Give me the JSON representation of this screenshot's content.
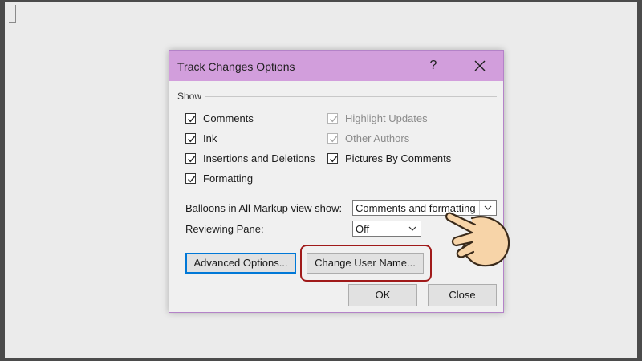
{
  "dialog": {
    "title": "Track Changes Options",
    "help_label": "?",
    "show_group_label": "Show",
    "checkboxes_left": [
      {
        "label": "Comments",
        "checked": true,
        "enabled": true
      },
      {
        "label": "Ink",
        "checked": true,
        "enabled": true
      },
      {
        "label": "Insertions and Deletions",
        "checked": true,
        "enabled": true
      },
      {
        "label": "Formatting",
        "checked": true,
        "enabled": true
      }
    ],
    "checkboxes_right": [
      {
        "label": "Highlight Updates",
        "checked": true,
        "enabled": false
      },
      {
        "label": "Other Authors",
        "checked": true,
        "enabled": false
      },
      {
        "label": "Pictures By Comments",
        "checked": true,
        "enabled": true
      }
    ],
    "balloons_label": "Balloons in All Markup view show:",
    "balloons_value": "Comments and formatting",
    "reviewing_pane_label": "Reviewing Pane:",
    "reviewing_pane_value": "Off",
    "advanced_options_label": "Advanced Options...",
    "change_user_name_label": "Change User Name...",
    "ok_label": "OK",
    "close_label": "Close"
  },
  "colors": {
    "titlebar": "#d29edc",
    "highlight_ring": "#a01a1a",
    "default_button_border": "#0078d7"
  },
  "icons": {
    "close": "close-icon",
    "checkbox": "check-icon",
    "dropdown": "chevron-down-icon",
    "pointer": "pointing-hand-icon"
  }
}
